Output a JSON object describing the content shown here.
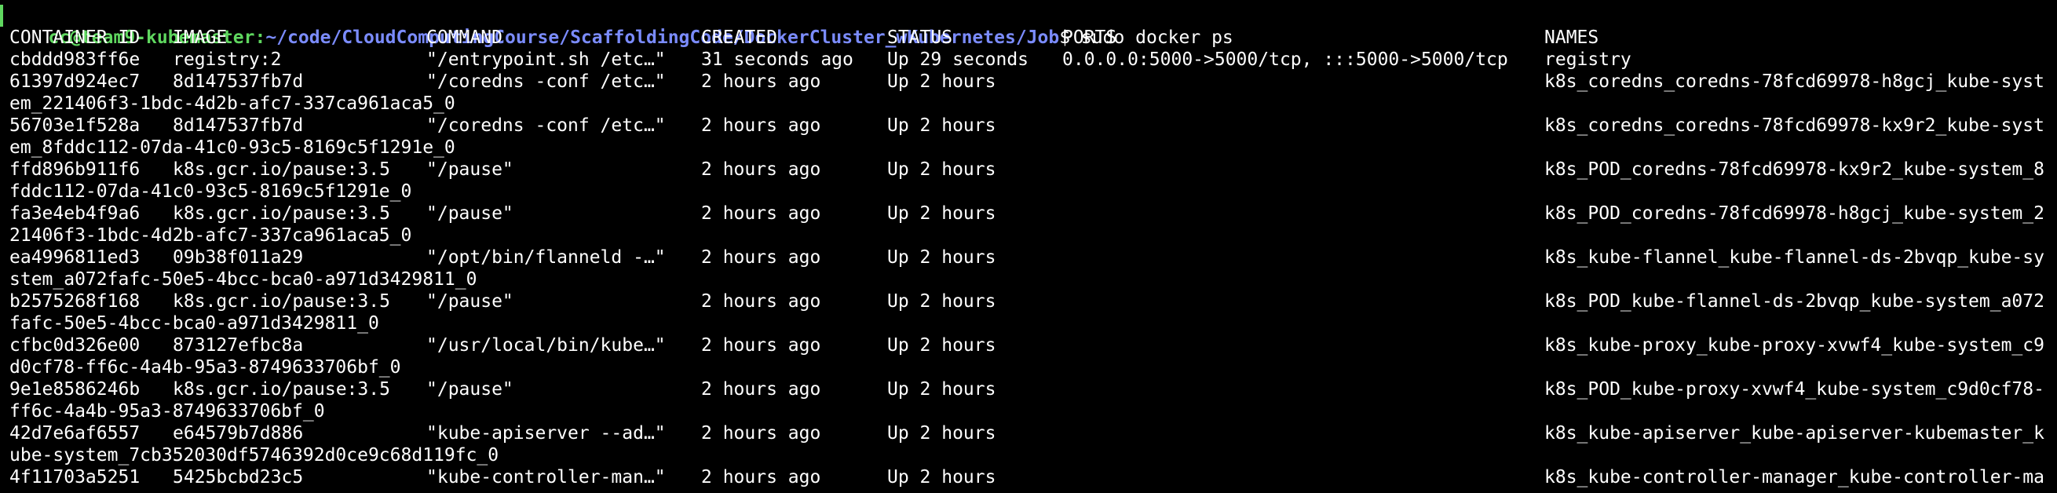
{
  "prompt": {
    "user_host": "cc@team9-kubemaster",
    "colon": ":",
    "path": "~/code/CloudComputingCourse/ScaffoldingCode/DockerCluster_wKubernetes/Job",
    "symbol": "$",
    "command": " sudo docker ps"
  },
  "headers": {
    "id": "CONTAINER ID",
    "image": "IMAGE",
    "command": "COMMAND",
    "created": "CREATED",
    "status": "STATUS",
    "ports": "PORTS",
    "names": "NAMES"
  },
  "rows": [
    {
      "id": "cbddd983ff6e",
      "image": "registry:2",
      "command": "\"/entrypoint.sh /etc…\"",
      "created": "31 seconds ago",
      "status": "Up 29 seconds",
      "ports": "0.0.0.0:5000->5000/tcp, :::5000->5000/tcp",
      "names": "registry",
      "wrap": ""
    },
    {
      "id": "61397d924ec7",
      "image": "8d147537fb7d",
      "command": "\"/coredns -conf /etc…\"",
      "created": "2 hours ago",
      "status": "Up 2 hours",
      "ports": "",
      "names": "k8s_coredns_coredns-78fcd69978-h8gcj_kube-syst",
      "wrap": "em_221406f3-1bdc-4d2b-afc7-337ca961aca5_0"
    },
    {
      "id": "56703e1f528a",
      "image": "8d147537fb7d",
      "command": "\"/coredns -conf /etc…\"",
      "created": "2 hours ago",
      "status": "Up 2 hours",
      "ports": "",
      "names": "k8s_coredns_coredns-78fcd69978-kx9r2_kube-syst",
      "wrap": "em_8fddc112-07da-41c0-93c5-8169c5f1291e_0"
    },
    {
      "id": "ffd896b911f6",
      "image": "k8s.gcr.io/pause:3.5",
      "command": "\"/pause\"",
      "created": "2 hours ago",
      "status": "Up 2 hours",
      "ports": "",
      "names": "k8s_POD_coredns-78fcd69978-kx9r2_kube-system_8",
      "wrap": "fddc112-07da-41c0-93c5-8169c5f1291e_0"
    },
    {
      "id": "fa3e4eb4f9a6",
      "image": "k8s.gcr.io/pause:3.5",
      "command": "\"/pause\"",
      "created": "2 hours ago",
      "status": "Up 2 hours",
      "ports": "",
      "names": "k8s_POD_coredns-78fcd69978-h8gcj_kube-system_2",
      "wrap": "21406f3-1bdc-4d2b-afc7-337ca961aca5_0"
    },
    {
      "id": "ea4996811ed3",
      "image": "09b38f011a29",
      "command": "\"/opt/bin/flanneld -…\"",
      "created": "2 hours ago",
      "status": "Up 2 hours",
      "ports": "",
      "names": "k8s_kube-flannel_kube-flannel-ds-2bvqp_kube-sy",
      "wrap": "stem_a072fafc-50e5-4bcc-bca0-a971d3429811_0"
    },
    {
      "id": "b2575268f168",
      "image": "k8s.gcr.io/pause:3.5",
      "command": "\"/pause\"",
      "created": "2 hours ago",
      "status": "Up 2 hours",
      "ports": "",
      "names": "k8s_POD_kube-flannel-ds-2bvqp_kube-system_a072",
      "wrap": "fafc-50e5-4bcc-bca0-a971d3429811_0"
    },
    {
      "id": "cfbc0d326e00",
      "image": "873127efbc8a",
      "command": "\"/usr/local/bin/kube…\"",
      "created": "2 hours ago",
      "status": "Up 2 hours",
      "ports": "",
      "names": "k8s_kube-proxy_kube-proxy-xvwf4_kube-system_c9",
      "wrap": "d0cf78-ff6c-4a4b-95a3-8749633706bf_0"
    },
    {
      "id": "9e1e8586246b",
      "image": "k8s.gcr.io/pause:3.5",
      "command": "\"/pause\"",
      "created": "2 hours ago",
      "status": "Up 2 hours",
      "ports": "",
      "names": "k8s_POD_kube-proxy-xvwf4_kube-system_c9d0cf78-",
      "wrap": "ff6c-4a4b-95a3-8749633706bf_0"
    },
    {
      "id": "42d7e6af6557",
      "image": "e64579b7d886",
      "command": "\"kube-apiserver --ad…\"",
      "created": "2 hours ago",
      "status": "Up 2 hours",
      "ports": "",
      "names": "k8s_kube-apiserver_kube-apiserver-kubemaster_k",
      "wrap": "ube-system_7cb352030df5746392d0ce9c68d119fc_0"
    },
    {
      "id": "4f11703a5251",
      "image": "5425bcbd23c5",
      "command": "\"kube-controller-man…\"",
      "created": "2 hours ago",
      "status": "Up 2 hours",
      "ports": "",
      "names": "k8s_kube-controller-manager_kube-controller-ma",
      "wrap": ""
    }
  ],
  "colors": {
    "background": "#000000",
    "text": "#ffffff",
    "prompt_user": "#5fd75f",
    "prompt_path": "#7b8cff"
  }
}
